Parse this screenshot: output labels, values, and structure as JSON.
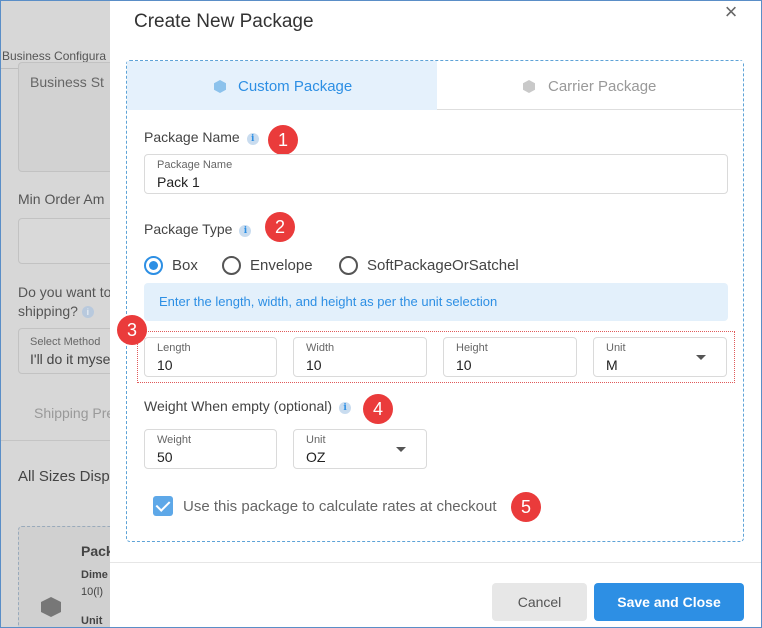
{
  "background": {
    "tab_label": "Business Configura",
    "textarea_value": "Business St",
    "min_order_label": "Min Order Am",
    "question_line1": "Do you want to",
    "question_line2": "shipping?",
    "select_label": "Select Method",
    "select_value": "I'll do it myse",
    "shipping_link": "Shipping Pre",
    "all_sizes_label": "All Sizes Disp",
    "card_title": "Pack",
    "card_dimensions_label": "Dime",
    "card_dimensions_value": "10(l)",
    "card_unit_label": "Unit"
  },
  "modal": {
    "title": "Create New Package",
    "close_symbol": "×",
    "tabs": [
      {
        "label": "Custom Package",
        "active": true
      },
      {
        "label": "Carrier Package",
        "active": false
      }
    ],
    "package_name": {
      "section_label": "Package Name",
      "field_label": "Package Name",
      "value": "Pack 1",
      "badge": "1"
    },
    "package_type": {
      "section_label": "Package Type",
      "badge": "2",
      "options": [
        "Box",
        "Envelope",
        "SoftPackageOrSatchel"
      ],
      "selected": "Box",
      "hint": "Enter the length, width, and height as per the unit selection"
    },
    "dimensions": {
      "badge": "3",
      "length": {
        "label": "Length",
        "value": "10"
      },
      "width": {
        "label": "Width",
        "value": "10"
      },
      "height": {
        "label": "Height",
        "value": "10"
      },
      "unit": {
        "label": "Unit",
        "value": "M"
      }
    },
    "weight": {
      "section_label": "Weight When empty (optional)",
      "badge": "4",
      "weight": {
        "label": "Weight",
        "value": "50"
      },
      "unit": {
        "label": "Unit",
        "value": "OZ"
      }
    },
    "checkout": {
      "label": "Use this package to calculate rates at checkout",
      "checked": true,
      "badge": "5"
    },
    "footer": {
      "cancel_label": "Cancel",
      "save_label": "Save and Close"
    }
  },
  "colors": {
    "accent": "#2d8fe4",
    "badge": "#ea3b3b",
    "active_tab_bg": "#e5f1fc"
  }
}
